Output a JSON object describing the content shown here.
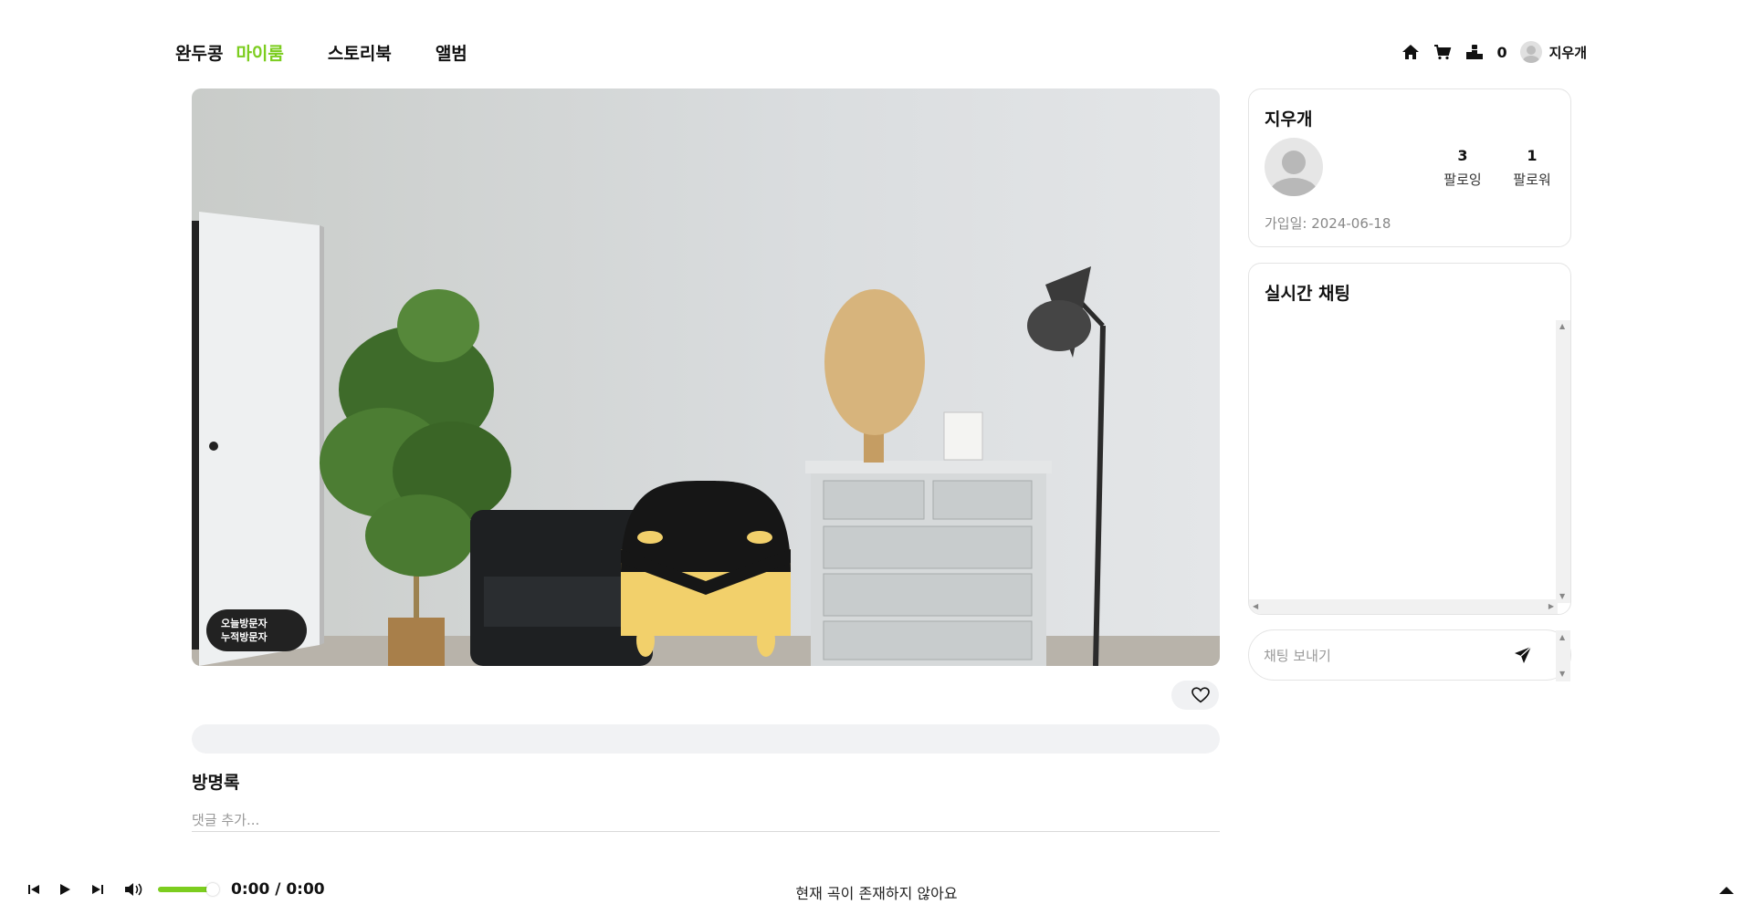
{
  "header": {
    "brand": "완두콩",
    "nav": [
      {
        "label": "마이룸",
        "active": true
      },
      {
        "label": "스토리북",
        "active": false
      },
      {
        "label": "앨범",
        "active": false
      }
    ],
    "right": {
      "icons": [
        "home-icon",
        "cart-icon",
        "ranking-icon"
      ],
      "count": "0",
      "username": "지우개"
    }
  },
  "room": {
    "visitors_today_label": "오늘방문자",
    "visitors_total_label": "누적방문자"
  },
  "guestbook": {
    "title": "방명록",
    "placeholder": "댓글 추가..."
  },
  "profile": {
    "name": "지우개",
    "following_count": "3",
    "following_label": "팔로잉",
    "followers_count": "1",
    "followers_label": "팔로워",
    "joined": "가입일: 2024-06-18"
  },
  "chat": {
    "title": "실시간 채팅",
    "placeholder": "채팅 보내기"
  },
  "player": {
    "time": "0:00 / 0:00",
    "status": "현재 곡이 존재하지 않아요",
    "volume": 0.85
  },
  "colors": {
    "accent": "#7ccd1f",
    "character_body": "#f2d06b",
    "character_head": "#161616"
  }
}
